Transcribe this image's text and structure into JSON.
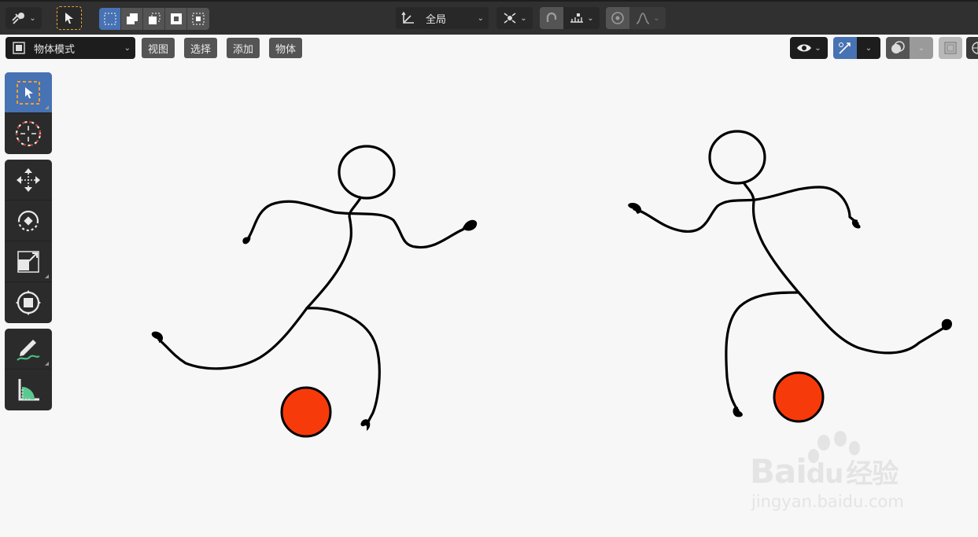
{
  "header": {
    "scene_pivot_label": "全局",
    "icons": [
      "editor-type-icon",
      "select-box-tool-icon",
      "selection-mode-icons",
      "transform-orientation-icon",
      "pivot-icon",
      "snap-icon",
      "snap-increment-icon",
      "proportional-edit-icon",
      "falloff-curve-icon"
    ]
  },
  "toolbar2": {
    "mode_label": "物体模式",
    "menus": [
      "视图",
      "选择",
      "添加",
      "物体"
    ]
  },
  "left_tools": [
    "select-box",
    "cursor",
    "move",
    "rotate",
    "scale",
    "transform",
    "annotate",
    "measure"
  ],
  "scene": {
    "stroke_color": "#000000",
    "ball_color": "#f73a0a",
    "background": "#f7f7f7"
  },
  "watermark": {
    "brand": "Bai",
    "brand_suffix": "du",
    "brand_cn": "经验",
    "url": "jingyan.baidu.com"
  }
}
